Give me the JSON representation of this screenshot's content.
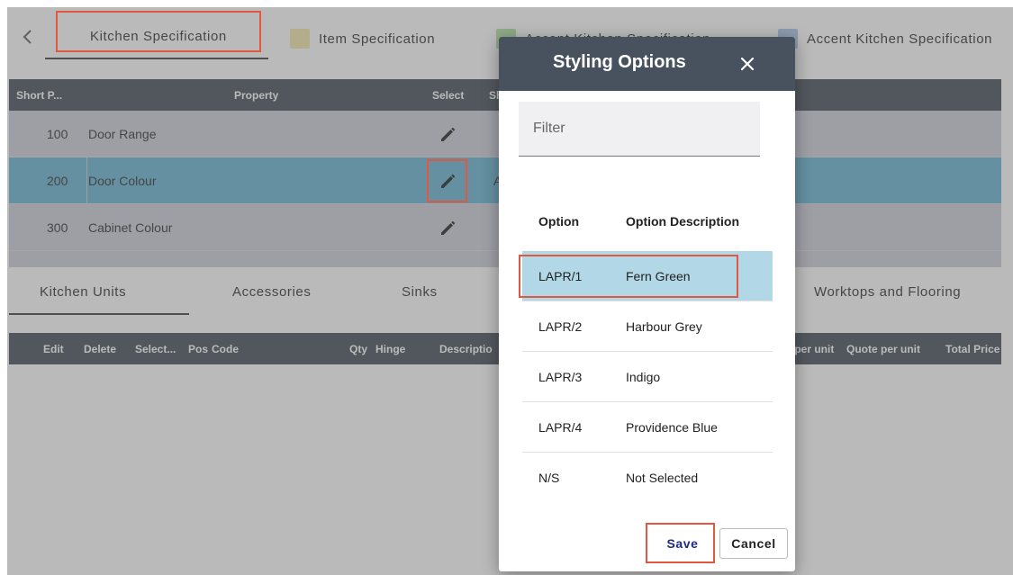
{
  "top_tabs": [
    {
      "label": "Kitchen Specification",
      "swatch": ""
    },
    {
      "label": "Item Specification",
      "swatch": "#f4e7a6"
    },
    {
      "label": "Accent Kitchen Specification",
      "swatch": "#a9e19a"
    },
    {
      "label": "Accent Kitchen Specification",
      "swatch": "#a6c4ea"
    }
  ],
  "property_table": {
    "headers": {
      "short": "Short P...",
      "property": "Property",
      "select": "Select",
      "short2": "Sh"
    },
    "rows": [
      {
        "code": "100",
        "property": "Door Range",
        "value": ""
      },
      {
        "code": "200",
        "property": "Door Colour",
        "value": "A"
      },
      {
        "code": "300",
        "property": "Cabinet Colour",
        "value": ""
      }
    ]
  },
  "lower_tabs": [
    "Kitchen Units",
    "Accessories",
    "Sinks",
    "Worktops and Flooring"
  ],
  "units_table": {
    "headers": [
      "Edit",
      "Delete",
      "Select...",
      "Pos",
      "Code",
      "Qty",
      "Hinge",
      "Descriptio",
      "t per unit",
      "Quote per unit",
      "Total Price"
    ]
  },
  "modal": {
    "title": "Styling Options",
    "filter_placeholder": "Filter",
    "col_option": "Option",
    "col_description": "Option Description",
    "options": [
      {
        "code": "LAPR/1",
        "description": "Fern Green"
      },
      {
        "code": "LAPR/2",
        "description": "Harbour Grey"
      },
      {
        "code": "LAPR/3",
        "description": "Indigo"
      },
      {
        "code": "LAPR/4",
        "description": "Providence Blue"
      },
      {
        "code": "N/S",
        "description": "Not Selected"
      }
    ],
    "selected_index": 0,
    "save_label": "Save",
    "cancel_label": "Cancel"
  },
  "colors": {
    "header_bg": "#37424e",
    "modal_header_bg": "#47525e",
    "selected_row": "#5aaed0",
    "highlight_red": "#e2573f"
  }
}
